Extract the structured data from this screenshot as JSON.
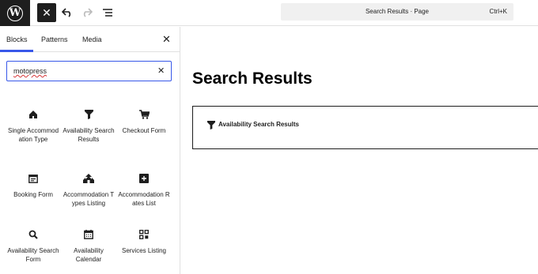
{
  "toolbar": {
    "logo_icon": "wordpress-icon",
    "close_icon": "close-icon",
    "undo_icon": "undo-icon",
    "redo_icon": "redo-icon",
    "outline_icon": "document-overview-icon",
    "command_title": "Search Results · Page",
    "command_shortcut": "Ctrl+K"
  },
  "inserter": {
    "tabs": [
      {
        "label": "Blocks",
        "active": true
      },
      {
        "label": "Patterns",
        "active": false
      },
      {
        "label": "Media",
        "active": false
      }
    ],
    "search": {
      "value": "motopress"
    },
    "blocks": [
      {
        "label": "Single Accommodation Type",
        "icon": "home-icon"
      },
      {
        "label": "Availability Search Results",
        "icon": "filter-icon"
      },
      {
        "label": "Checkout Form",
        "icon": "cart-icon"
      },
      {
        "label": "Booking Form",
        "icon": "form-icon"
      },
      {
        "label": "Accommodation Types Listing",
        "icon": "buildings-icon"
      },
      {
        "label": "Accommodation Rates List",
        "icon": "money-icon"
      },
      {
        "label": "Availability Search Form",
        "icon": "search-icon"
      },
      {
        "label": "Availability Calendar",
        "icon": "calendar-icon"
      },
      {
        "label": "Services Listing",
        "icon": "grid-icon"
      }
    ]
  },
  "canvas": {
    "title": "Search Results",
    "block_label": "Availability Search Results",
    "block_icon": "filter-icon"
  },
  "colors": {
    "accent": "#3858e9",
    "dark": "#1e1e1e",
    "spellcheck": "#d63638"
  }
}
